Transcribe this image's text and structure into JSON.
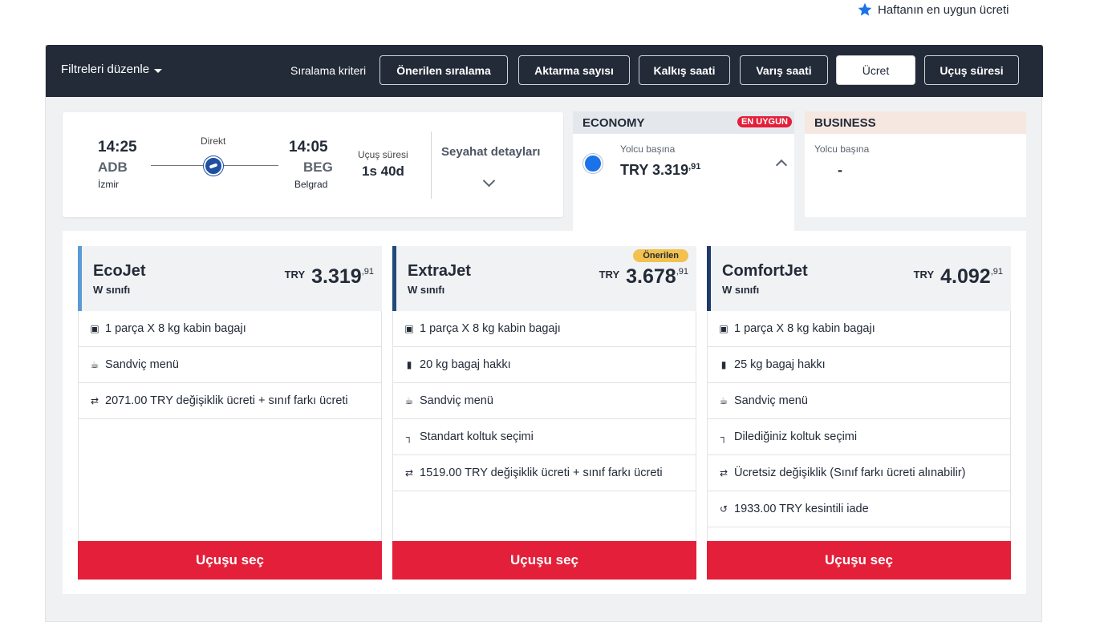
{
  "top_note": {
    "label": "Haftanın en uygun ücreti",
    "icon": "star-icon",
    "color": "#1a73e8"
  },
  "toolbar": {
    "filter_edit": "Filtreleri düzenle",
    "sort_label": "Sıralama kriteri",
    "sort_options": [
      "Önerilen sıralama",
      "Aktarma sayısı",
      "Kalkış saati",
      "Varış saati",
      "Ücret",
      "Uçuş süresi"
    ],
    "active_sort": "Ücret"
  },
  "flight": {
    "dep_time": "14:25",
    "dep_code": "ADB",
    "dep_city": "İzmir",
    "arr_time": "14:05",
    "arr_code": "BEG",
    "arr_city": "Belgrad",
    "stop_type": "Direkt",
    "duration_label": "Uçuş süresi",
    "duration": "1s 40d",
    "details_label": "Seyahat detayları"
  },
  "cabins": {
    "economy": {
      "name": "ECONOMY",
      "badge": "EN UYGUN",
      "per_pax": "Yolcu başına",
      "currency": "TRY",
      "price": "3.319",
      "price_dec": ",91",
      "selected": true
    },
    "business": {
      "name": "BUSINESS",
      "per_pax": "Yolcu başına",
      "price": "-"
    }
  },
  "fares": [
    {
      "name": "EcoJet",
      "class": "W sınıfı",
      "currency": "TRY",
      "price": "3.319",
      "price_dec": ",91",
      "accent": "#5b9bd5",
      "badge": "",
      "features": [
        {
          "icon": "cabin-bag-icon",
          "text": "1 parça X 8 kg kabin bagajı"
        },
        {
          "icon": "meal-icon",
          "text": "Sandviç menü"
        },
        {
          "icon": "change-fee-icon",
          "text": "2071.00 TRY değişiklik ücreti + sınıf farkı ücreti"
        }
      ],
      "button": "Uçuşu seç"
    },
    {
      "name": "ExtraJet",
      "class": "W sınıfı",
      "currency": "TRY",
      "price": "3.678",
      "price_dec": ",91",
      "accent": "#1f4a7c",
      "badge": "Önerilen",
      "features": [
        {
          "icon": "cabin-bag-icon",
          "text": "1 parça X 8 kg kabin bagajı"
        },
        {
          "icon": "luggage-icon",
          "text": "20 kg bagaj hakkı"
        },
        {
          "icon": "meal-icon",
          "text": "Sandviç menü"
        },
        {
          "icon": "seat-icon",
          "text": "Standart koltuk seçimi"
        },
        {
          "icon": "change-fee-icon",
          "text": "1519.00 TRY değişiklik ücreti + sınıf farkı ücreti"
        }
      ],
      "button": "Uçuşu seç"
    },
    {
      "name": "ComfortJet",
      "class": "W sınıfı",
      "currency": "TRY",
      "price": "4.092",
      "price_dec": ",91",
      "accent": "#1f3a6b",
      "badge": "",
      "features": [
        {
          "icon": "cabin-bag-icon",
          "text": "1 parça X 8 kg kabin bagajı"
        },
        {
          "icon": "luggage-icon",
          "text": "25 kg bagaj hakkı"
        },
        {
          "icon": "meal-icon",
          "text": "Sandviç menü"
        },
        {
          "icon": "seat-icon",
          "text": "Dilediğiniz koltuk seçimi"
        },
        {
          "icon": "change-fee-icon",
          "text": "Ücretsiz değişiklik (Sınıf farkı ücreti alınabilir)"
        },
        {
          "icon": "refund-icon",
          "text": "1933.00 TRY kesintili iade"
        }
      ],
      "button": "Uçuşu seç"
    }
  ],
  "colors": {
    "toolbar_bg": "#232b38",
    "select_button": "#e31f3a",
    "badge_best": "#e31f3a",
    "badge_recommended": "#f2c14e"
  }
}
